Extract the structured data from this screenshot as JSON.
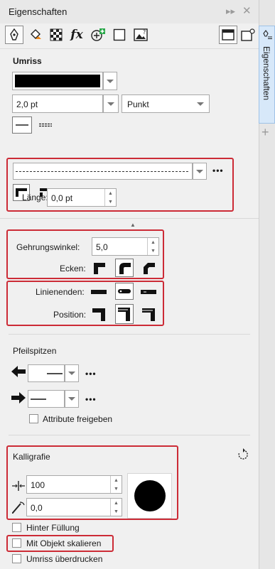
{
  "panel": {
    "title": "Eigenschaften"
  },
  "sidebar": {
    "tab_label": "Eigenschaften",
    "add_symbol": "+"
  },
  "toolbar": {
    "fx_label": "fx"
  },
  "umriss": {
    "title": "Umriss",
    "width_value": "2,0 pt",
    "unit_value": "Punkt",
    "more_label": "•••",
    "length_label": "Länge:",
    "length_value": "0,0 pt"
  },
  "miter": {
    "label": "Gehrungswinkel:",
    "value": "5,0",
    "corners_label": "Ecken:"
  },
  "line_ends": {
    "label": "Linienenden:",
    "position_label": "Position:"
  },
  "pfeilspitzen": {
    "title": "Pfeilspitzen",
    "more_label": "•••",
    "share_label": "Attribute freigeben",
    "share_checked": false
  },
  "kalligrafie": {
    "title": "Kalligrafie",
    "width_value": "100",
    "angle_value": "0,0"
  },
  "options": [
    {
      "label": "Hinter Füllung",
      "checked": false
    },
    {
      "label": "Mit Objekt skalieren",
      "checked": false
    },
    {
      "label": "Umriss überdrucken",
      "checked": false
    }
  ],
  "colors": {
    "accent_red": "#cc2b36",
    "outline_color": "#000000",
    "tab_bg": "#d7e8f9"
  }
}
